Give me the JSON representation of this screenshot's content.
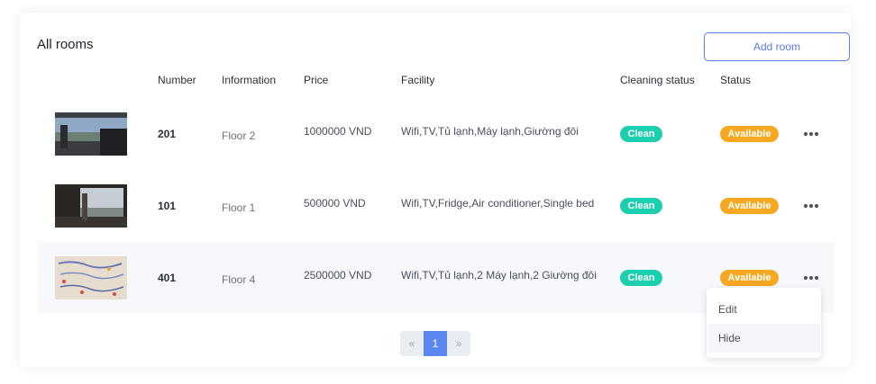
{
  "page": {
    "title": "All rooms",
    "add_button": "Add room"
  },
  "table": {
    "columns": [
      "Number",
      "Information",
      "Price",
      "Facility",
      "Cleaning status",
      "Status"
    ],
    "rows": [
      {
        "number": "201",
        "info": "Floor 2",
        "price": "1000000 VND",
        "facility": "Wifi,TV,Tủ lạnh,Máy lạnh,Giường đôi",
        "cleaning": "Clean",
        "status": "Available"
      },
      {
        "number": "101",
        "info": "Floor 1",
        "price": "500000 VND",
        "facility": "Wifi,TV,Fridge,Air conditioner,Single bed",
        "cleaning": "Clean",
        "status": "Available"
      },
      {
        "number": "401",
        "info": "Floor 4",
        "price": "2500000 VND",
        "facility": "Wifi,TV,Tủ lạnh,2 Máy lạnh,2 Giường đôi",
        "cleaning": "Clean",
        "status": "Available"
      }
    ]
  },
  "colors": {
    "accent": "#5b79e6",
    "clean_badge": "#1ccfae",
    "available_badge": "#f7a823",
    "pagination_active": "#5b86f0"
  },
  "pagination": {
    "prev": "«",
    "current": "1",
    "next": "»"
  },
  "menu": {
    "items": [
      "Edit",
      "Hide"
    ]
  }
}
